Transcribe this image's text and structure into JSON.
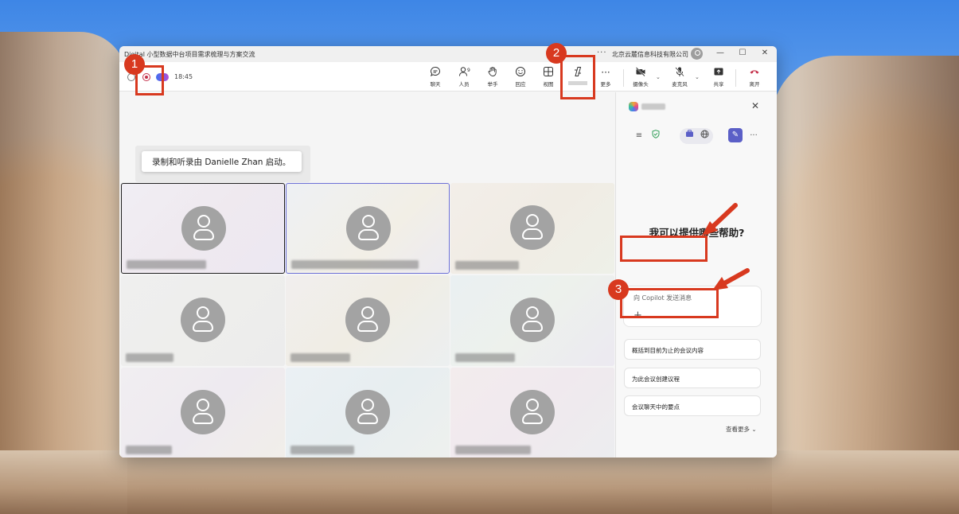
{
  "window": {
    "title": "Digital 小型数据中台项目需求梳理与方案交流",
    "more": "···",
    "org": "北京云麓信息科技有限公司",
    "controls": {
      "minimize": "—",
      "maximize": "☐",
      "close": "✕"
    }
  },
  "toolbar": {
    "timer": "18:45",
    "buttons": [
      {
        "label": "聊天",
        "icon": "chat-icon"
      },
      {
        "label": "人员",
        "icon": "people-icon",
        "count": "9"
      },
      {
        "label": "举手",
        "icon": "raise-hand-icon"
      },
      {
        "label": "回应",
        "icon": "react-icon"
      },
      {
        "label": "视图",
        "icon": "view-icon"
      },
      {
        "label": "",
        "icon": "copilot-icon"
      },
      {
        "label": "更多",
        "icon": "more-icon"
      },
      {
        "label": "摄像头",
        "icon": "camera-off-icon"
      },
      {
        "label": "麦克风",
        "icon": "mic-off-icon"
      },
      {
        "label": "共享",
        "icon": "share-icon"
      },
      {
        "label": "离开",
        "icon": "leave-icon"
      }
    ]
  },
  "toast": {
    "text": "录制和听录由 Danielle Zhan 启动。"
  },
  "copilot_panel": {
    "heading": "我可以提供哪些帮助?",
    "input_placeholder": "向 Copilot 发送消息",
    "add": "+",
    "suggestions": [
      "概括到目前为止的会议内容",
      "为此会议创建议程",
      "会议聊天中的要点"
    ],
    "see_more": "查看更多 ⌄",
    "close": "✕",
    "menu": "≡",
    "more": "···"
  },
  "annotations": {
    "badge1": "1",
    "badge2": "2",
    "badge3": "3"
  },
  "colors": {
    "accent": "#5b5fc7",
    "record": "#c4314b",
    "annotation": "#d8391f",
    "leave": "#c4314b"
  }
}
